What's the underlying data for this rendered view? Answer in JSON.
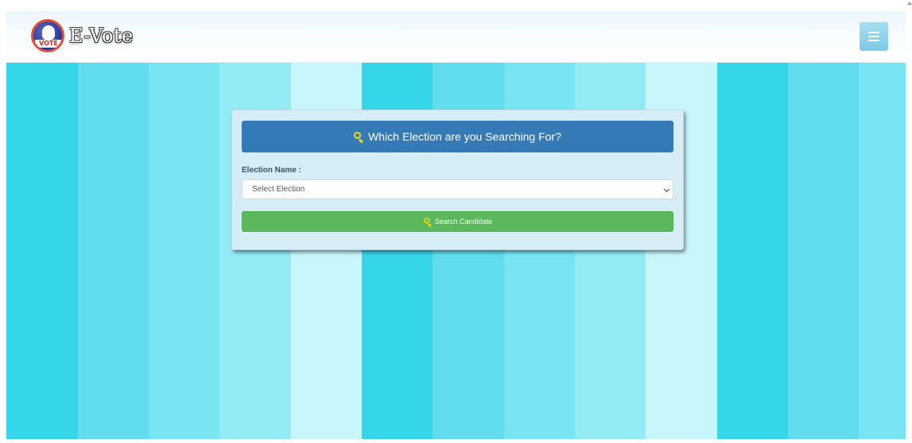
{
  "header": {
    "brand_name": "E-Vote",
    "logo_text": "VOTE"
  },
  "search_card": {
    "title": "Which Election are you Searching For?",
    "field_label": "Election Name :",
    "select_value": "Select Election",
    "button_label": "Search Candidate"
  },
  "icons": {
    "logo": "vote-hand-logo",
    "menu": "hamburger-icon",
    "search": "search-icon",
    "dropdown": "chevron-down-icon"
  },
  "colors": {
    "header_panel": "#337ab7",
    "button": "#5cb85c",
    "search_icon": "#f5d90a",
    "card_bg": "#d7edf5",
    "stripes": [
      "#35d6ea",
      "#62ddef",
      "#78e5f3",
      "#93ebf6",
      "#c7f6fc",
      "#35d6ea",
      "#62ddef",
      "#78e5f3",
      "#93ebf6",
      "#c7f6fc",
      "#35d6ea",
      "#62ddef",
      "#78e5f3"
    ]
  }
}
